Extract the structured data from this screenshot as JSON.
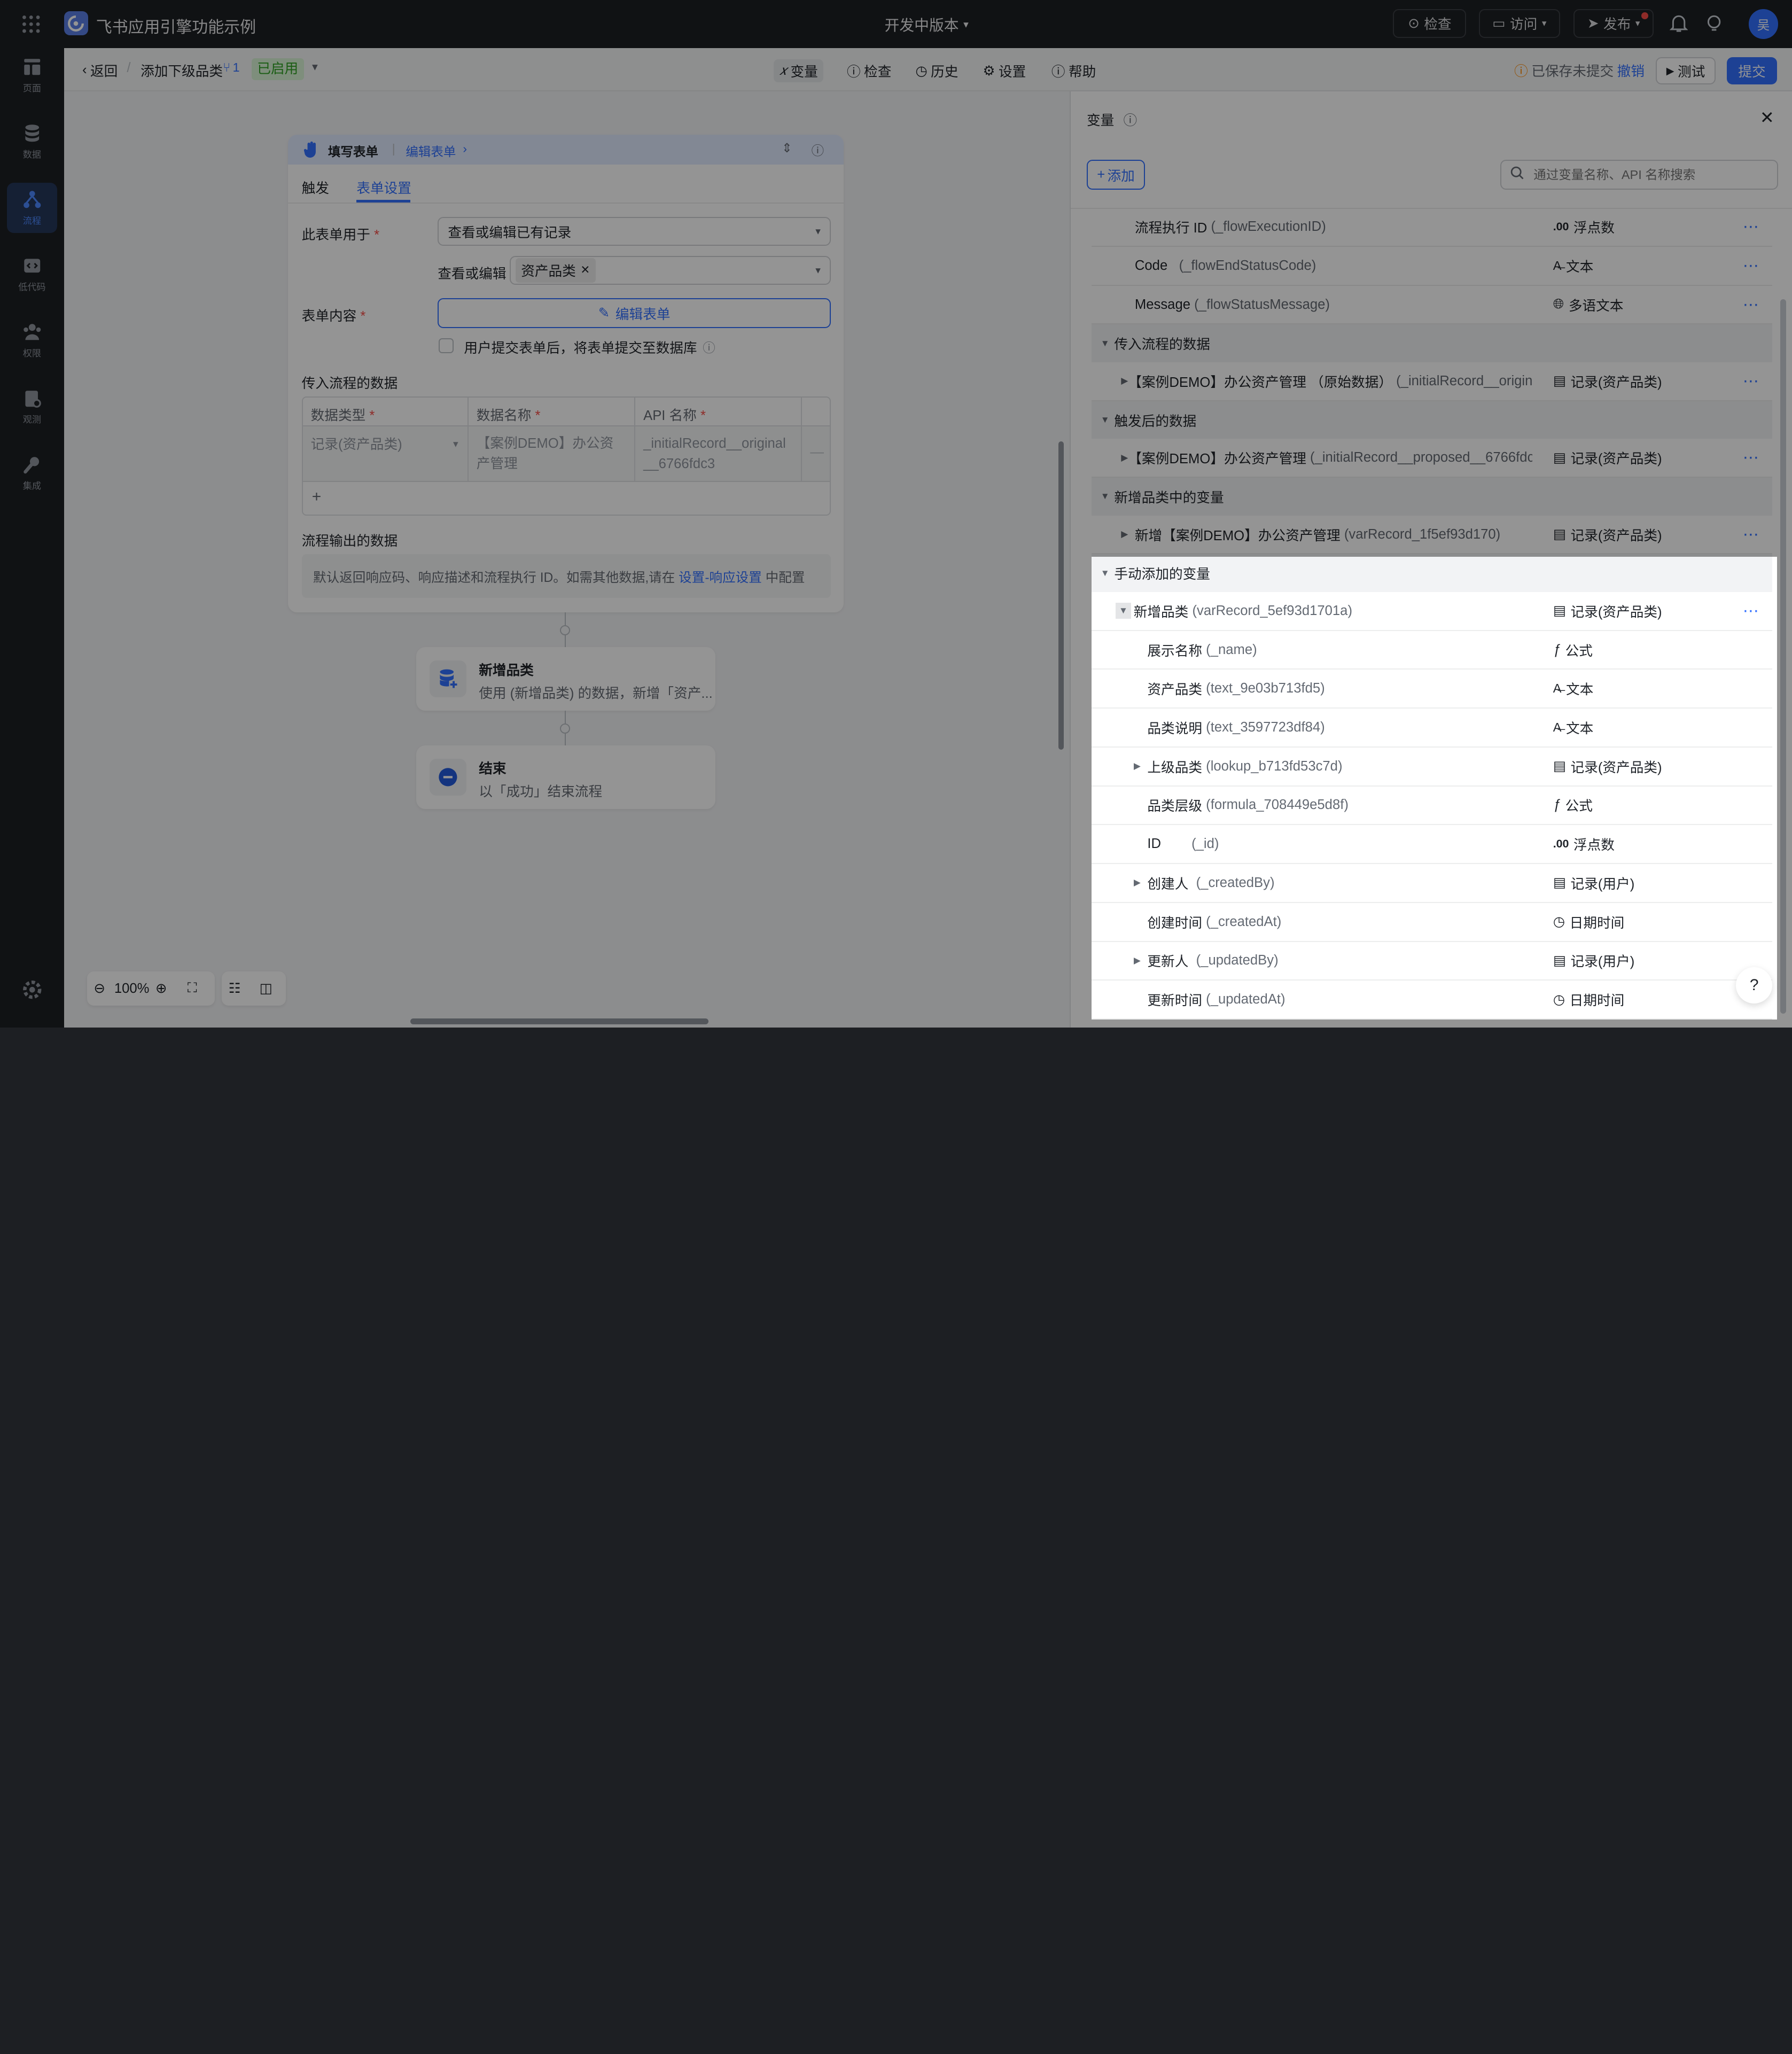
{
  "header": {
    "app_title": "飞书应用引擎功能示例",
    "version": "开发中版本",
    "inspect": "检查",
    "visit": "访问",
    "publish": "发布",
    "avatar_initial": "吴"
  },
  "nav": {
    "items": [
      {
        "label": "页面",
        "icon": "pages-icon"
      },
      {
        "label": "数据",
        "icon": "database-icon"
      },
      {
        "label": "流程",
        "icon": "flow-icon",
        "active": true
      },
      {
        "label": "低代码",
        "icon": "code-icon"
      },
      {
        "label": "权限",
        "icon": "users-icon"
      },
      {
        "label": "观测",
        "icon": "monitor-icon"
      },
      {
        "label": "集成",
        "icon": "wrench-icon"
      }
    ]
  },
  "subbar": {
    "back": "返回",
    "flow_name": "添加下级品类",
    "version_no": "1",
    "status": "已启用",
    "tools": [
      "变量",
      "检查",
      "历史",
      "设置",
      "帮助"
    ],
    "saved_notice": "已保存未提交",
    "undo": "撤销",
    "test": "测试",
    "submit": "提交"
  },
  "form_card": {
    "title": "填写表单",
    "edit_link": "编辑表单",
    "tabs": [
      "触发",
      "表单设置"
    ],
    "purpose_label": "此表单用于",
    "purpose_value": "查看或编辑已有记录",
    "view_edit_label": "查看或编辑",
    "view_edit_tag": "资产品类",
    "content_label": "表单内容",
    "edit_form_button": "编辑表单",
    "save_checkbox": "用户提交表单后，将表单提交至数据库",
    "input_section": "传入流程的数据",
    "table_headers": [
      "数据类型",
      "数据名称",
      "API 名称"
    ],
    "table_row": [
      "记录(资产品类)",
      "【案例DEMO】办公资产管理",
      "_initialRecord__original__6766fdc3"
    ],
    "add_row": "+",
    "output_section": "流程输出的数据",
    "output_note": "默认返回响应码、响应描述和流程执行 ID。如需其他数据,请在",
    "output_link": "设置-响应设置",
    "output_note_end": "中配置"
  },
  "nodes": [
    {
      "title": "新增品类",
      "desc": "使用 (新增品类) 的数据，新增「资产..."
    },
    {
      "title": "结束",
      "desc": "以「成功」结束流程"
    }
  ],
  "zoom": {
    "level": "100%"
  },
  "variables": {
    "title": "变量",
    "add": "添加",
    "search_placeholder": "通过变量名称、API 名称搜索",
    "rows": [
      {
        "name": "流程执行 ID",
        "api": "(_flowExecutionID)",
        "type": "浮点数",
        "type_icon": ".00",
        "more": true
      },
      {
        "name": "Code",
        "api": "(_flowEndStatusCode)",
        "type": "文本",
        "type_icon": "text",
        "more": true
      },
      {
        "name": "Message",
        "api": "(_flowStatusMessage)",
        "type": "多语文本",
        "type_icon": "globe",
        "more": true
      }
    ],
    "group_input": "传入流程的数据",
    "row_input": {
      "name": "【案例DEMO】办公资产管理 （原始数据）",
      "api": "(_initialRecord__original...",
      "type": "记录(资产品类)"
    },
    "group_trigger": "触发后的数据",
    "row_trigger": {
      "name": "【案例DEMO】办公资产管理",
      "api": "(_initialRecord__proposed__6766fdc...",
      "type": "记录(资产品类)"
    },
    "group_new": "新增品类中的变量",
    "row_new": {
      "name": "新增【案例DEMO】办公资产管理",
      "api": "(varRecord_1f5ef93d170)",
      "type": "记录(资产品类)"
    },
    "group_manual": "手动添加的变量",
    "row_manual": {
      "name": "新增品类",
      "api": "(varRecord_5ef93d1701a)",
      "type": "记录(资产品类)"
    },
    "children": [
      {
        "name": "展示名称",
        "api": "(_name)",
        "type": "公式",
        "type_icon": "fx",
        "expand": false
      },
      {
        "name": "资产品类",
        "api": "(text_9e03b713fd5)",
        "type": "文本",
        "type_icon": "text",
        "expand": false
      },
      {
        "name": "品类说明",
        "api": "(text_3597723df84)",
        "type": "文本",
        "type_icon": "text",
        "expand": false
      },
      {
        "name": "上级品类",
        "api": "(lookup_b713fd53c7d)",
        "type": "记录(资产品类)",
        "type_icon": "record",
        "expand": true
      },
      {
        "name": "品类层级",
        "api": "(formula_708449e5d8f)",
        "type": "公式",
        "type_icon": "fx",
        "expand": false
      },
      {
        "name": "ID",
        "api": "(_id)",
        "type": "浮点数",
        "type_icon": ".00",
        "expand": false
      },
      {
        "name": "创建人",
        "api": "(_createdBy)",
        "type": "记录(用户)",
        "type_icon": "record",
        "expand": true
      },
      {
        "name": "创建时间",
        "api": "(_createdAt)",
        "type": "日期时间",
        "type_icon": "clock",
        "expand": false
      },
      {
        "name": "更新人",
        "api": "(_updatedBy)",
        "type": "记录(用户)",
        "type_icon": "record",
        "expand": true
      },
      {
        "name": "更新时间",
        "api": "(_updatedAt)",
        "type": "日期时间",
        "type_icon": "clock",
        "expand": false
      }
    ]
  },
  "colors": {
    "accent": "#3370ff",
    "topbar": "#1d1f23",
    "status_green": "#2ea121"
  }
}
